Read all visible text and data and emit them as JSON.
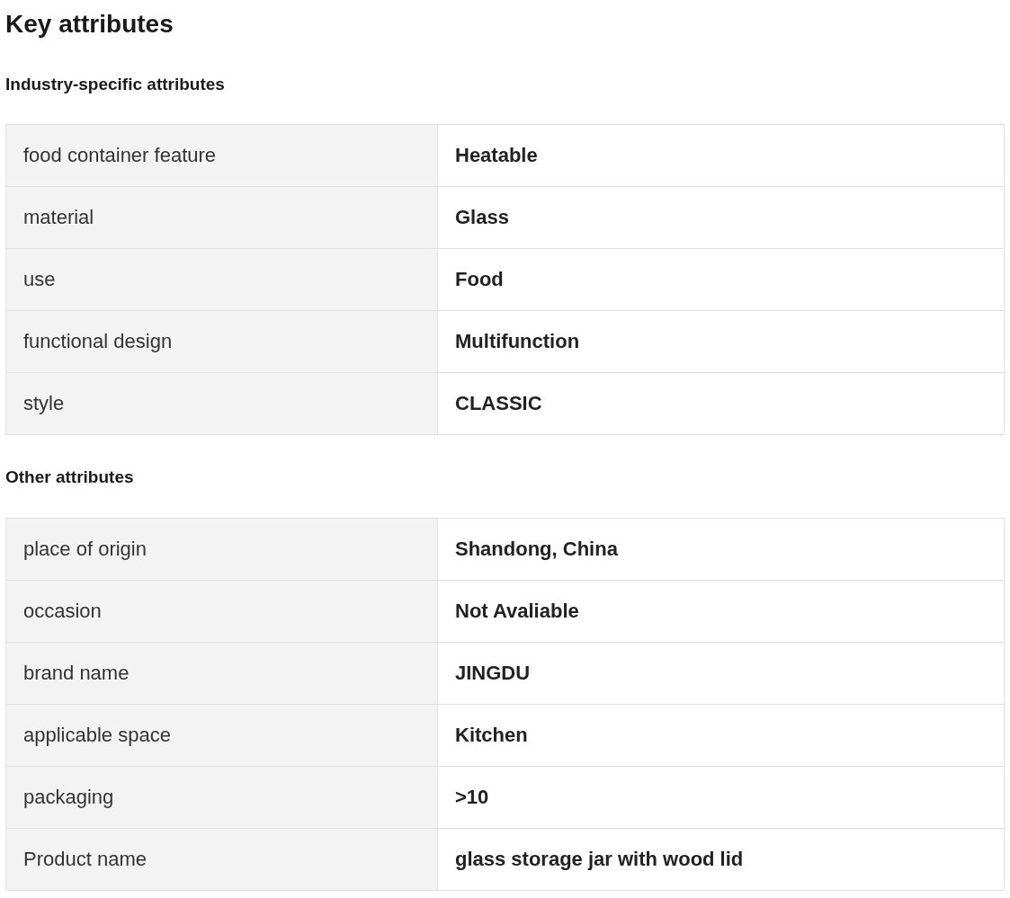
{
  "title": "Key attributes",
  "sections": [
    {
      "heading": "Industry-specific attributes",
      "rows": [
        {
          "name": "food container feature",
          "value": "Heatable"
        },
        {
          "name": "material",
          "value": "Glass"
        },
        {
          "name": "use",
          "value": "Food"
        },
        {
          "name": "functional design",
          "value": "Multifunction"
        },
        {
          "name": "style",
          "value": "CLASSIC"
        }
      ]
    },
    {
      "heading": "Other attributes",
      "rows": [
        {
          "name": "place of origin",
          "value": "Shandong, China"
        },
        {
          "name": "occasion",
          "value": "Not Avaliable"
        },
        {
          "name": "brand name",
          "value": "JINGDU"
        },
        {
          "name": "applicable space",
          "value": "Kitchen"
        },
        {
          "name": "packaging",
          "value": ">10"
        },
        {
          "name": "Product name",
          "value": "glass storage jar with wood lid"
        }
      ]
    }
  ]
}
